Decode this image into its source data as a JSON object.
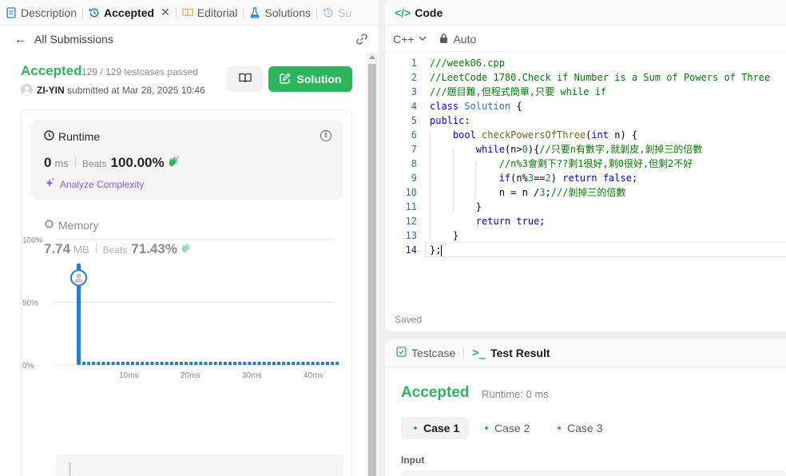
{
  "tabs": [
    {
      "label": "Description",
      "icon": "document-icon"
    },
    {
      "label": "Accepted",
      "icon": "history-icon",
      "active": true
    },
    {
      "label": "Editorial",
      "icon": "book-icon"
    },
    {
      "label": "Solutions",
      "icon": "flask-icon"
    },
    {
      "label": "Su",
      "icon": "history-icon"
    }
  ],
  "subheader": {
    "back_label": "All Submissions"
  },
  "submission": {
    "status": "Accepted",
    "testcases": "129 / 129 testcases passed",
    "user": "ZI-YIN",
    "submitted_text": "submitted at Mar 28, 2025 10:46",
    "solution_label": "Solution"
  },
  "runtime": {
    "label": "Runtime",
    "value": "0",
    "unit": "ms",
    "beats_label": "Beats",
    "beats_value": "100.00%",
    "analyze_label": "Analyze Complexity"
  },
  "memory": {
    "label": "Memory",
    "value": "7.74",
    "unit": "MB",
    "beats_label": "Beats",
    "beats_value": "71.43%"
  },
  "chart_data": {
    "type": "bar",
    "y_ticks": [
      "100%",
      "50%",
      "0%"
    ],
    "x_ticks": [
      "10ms",
      "20ms",
      "30ms",
      "40ms"
    ],
    "ylim": [
      0,
      100
    ],
    "highlight_bar": {
      "x": "0ms",
      "value": 81
    },
    "colors": {
      "bar": "#1e7fd9",
      "grid": "#e5e5e5"
    }
  },
  "editor": {
    "title": "Code",
    "language": "C++",
    "mode": "Auto",
    "saved_label": "Saved",
    "current_line": 14,
    "lines": [
      "///week06.cpp",
      "//LeetCode 1780.Check if Number is a Sum of Powers of Three",
      "///題目難,但程式簡單,只要 while if",
      "class Solution {",
      "public:",
      "    bool checkPowersOfThree(int n) {",
      "        while(n>0){//只要n有數字,就剝皮,剝掉三的倍數",
      "            //n%3會剩下??剩1很好,剩0很好,但剩2不好",
      "            if(n%3==2) return false;",
      "            n = n /3;///剝掉三的倍數",
      "        }",
      "        return true;",
      "    }",
      "};"
    ]
  },
  "result": {
    "tab_testcase": "Testcase",
    "tab_result": "Test Result",
    "status": "Accepted",
    "runtime": "Runtime: 0 ms",
    "cases": [
      "Case 1",
      "Case 2",
      "Case 3"
    ],
    "input_label": "Input"
  }
}
